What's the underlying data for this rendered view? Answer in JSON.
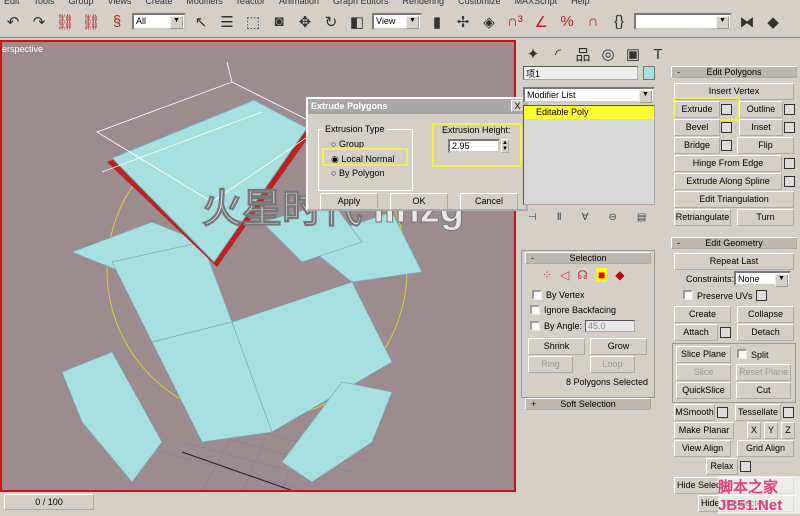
{
  "menu": [
    "Edit",
    "Tools",
    "Group",
    "Views",
    "Create",
    "Modifiers",
    "reactor",
    "Animation",
    "Graph Editors",
    "Rendering",
    "Customize",
    "MAXScript",
    "Help"
  ],
  "toolbar": {
    "selection_filter": "All",
    "ref_coord": "View",
    "named_sel": ""
  },
  "viewport": {
    "label": "erspective",
    "watermark": "火星时代 linzg"
  },
  "timeline": {
    "frame": "0 / 100"
  },
  "dialog": {
    "title": "Extrude Polygons",
    "type_label": "Extrusion Type",
    "options": [
      "Group",
      "Local Normal",
      "By Polygon"
    ],
    "selected": "Local Normal",
    "height_label": "Extrusion Height:",
    "height_value": "2.95",
    "apply": "Apply",
    "ok": "OK",
    "cancel": "Cancel",
    "close": "X"
  },
  "panel": {
    "object_name": "项1",
    "modifier_list": "Modifier List",
    "stack_item": "Editable Poly",
    "edit_polygons": {
      "title": "Edit Polygons",
      "insert_vertex": "Insert Vertex",
      "extrude": "Extrude",
      "outline": "Outline",
      "bevel": "Bevel",
      "inset": "Inset",
      "bridge": "Bridge",
      "flip": "Flip",
      "hinge": "Hinge From Edge",
      "extrude_spline": "Extrude Along Spline",
      "edit_tri": "Edit Triangulation",
      "retri": "Retriangulate",
      "turn": "Turn"
    },
    "selection": {
      "title": "Selection",
      "by_vertex": "By Vertex",
      "ignore_backfacing": "Ignore Backfacing",
      "by_angle": "By Angle:",
      "angle": "45.0",
      "shrink": "Shrink",
      "grow": "Grow",
      "ring": "Ring",
      "loop": "Loop",
      "status": "8 Polygons Selected"
    },
    "soft_selection": {
      "title": "Soft Selection"
    },
    "edit_geometry": {
      "title": "Edit Geometry",
      "repeat_last": "Repeat Last",
      "constraints": "Constraints:",
      "constraint_value": "None",
      "preserve_uvs": "Preserve UVs",
      "create": "Create",
      "collapse": "Collapse",
      "attach": "Attach",
      "detach": "Detach",
      "slice_plane": "Slice Plane",
      "split": "Split",
      "slice": "Slice",
      "reset_plane": "Reset Plane",
      "quickslice": "QuickSlice",
      "cut": "Cut",
      "msmooth": "MSmooth",
      "tessellate": "Tessellate",
      "make_planar": "Make Planar",
      "x": "X",
      "y": "Y",
      "z": "Z",
      "view_align": "View Align",
      "grid_align": "Grid Align",
      "relax": "Relax",
      "hide_selected": "Hide Selected",
      "hide_unselected": "Hide Unselected"
    },
    "watermark2": "脚本之家 JB51.Net"
  },
  "colors": {
    "viewport_bg": "#9c8b8f",
    "object": "#a8e0e0",
    "highlight": "#f0f050",
    "selection_red": "#c01818"
  }
}
